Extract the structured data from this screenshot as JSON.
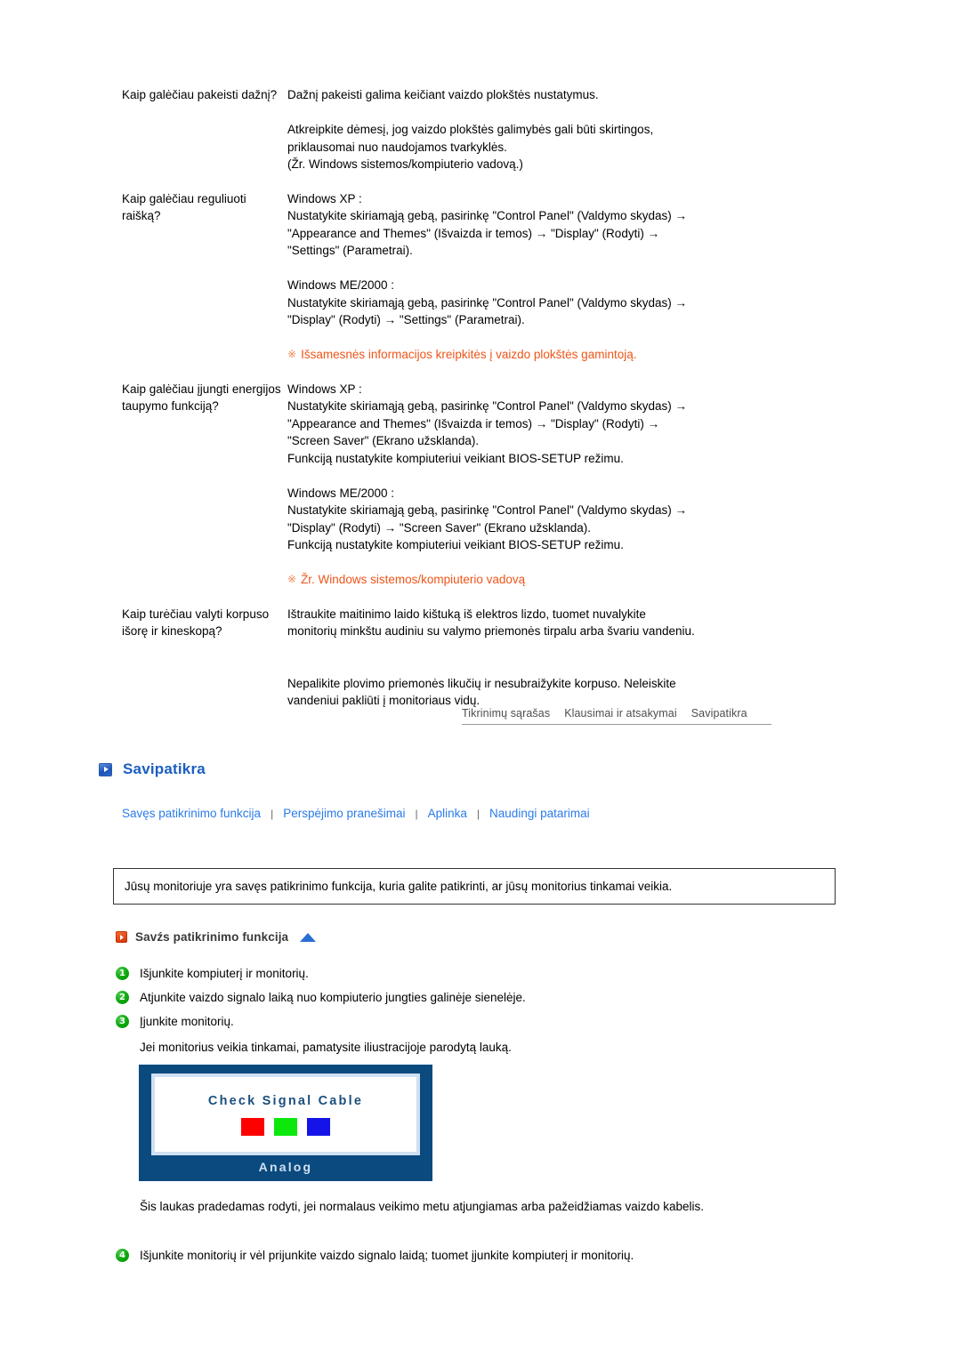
{
  "faq": {
    "items": [
      {
        "question": "Kaip galėčiau pakeisti dažnį?",
        "answer_blocks": [
          "Dažnį pakeisti galima keičiant vaizdo plokštės nustatymus.",
          "Atkreipkite dėmesį, jog vaizdo plokštės galimybės gali būti skirtingos,\npriklausomai nuo naudojamos tvarkyklės.\n(Žr. Windows sistemos/kompiuterio vadovą.)"
        ],
        "note": null
      },
      {
        "question": "Kaip galėčiau reguliuoti raišką?",
        "answer_blocks": [
          "Windows XP :\nNustatykite skiriamąją gebą, pasirinkę \"Control Panel\" (Valdymo skydas) →\n\"Appearance and Themes\" (Išvaizda ir temos) → \"Display\" (Rodyti) →\n\"Settings\" (Parametrai).",
          "Windows ME/2000 :\nNustatykite skiriamąją gebą, pasirinkę \"Control Panel\" (Valdymo skydas) →\n\"Display\" (Rodyti) → \"Settings\" (Parametrai)."
        ],
        "note": "Išsamesnės informacijos kreipkitės į vaizdo plokštės gamintoją."
      },
      {
        "question": "Kaip galėčiau įjungti energijos taupymo funkciją?",
        "answer_blocks": [
          "Windows XP :\nNustatykite skiriamąją gebą, pasirinkę \"Control Panel\" (Valdymo skydas) →\n\"Appearance and Themes\" (Išvaizda ir temos) → \"Display\" (Rodyti) →\n\"Screen Saver\" (Ekrano užsklanda).\nFunkciją nustatykite kompiuteriui veikiant BIOS-SETUP režimu.",
          "Windows ME/2000 :\nNustatykite skiriamąją gebą, pasirinkę \"Control Panel\" (Valdymo skydas) →\n\"Display\" (Rodyti) → \"Screen Saver\" (Ekrano užsklanda).\nFunkciją nustatykite kompiuteriui veikiant BIOS-SETUP režimu."
        ],
        "note": "Žr. Windows sistemos/kompiuterio vadovą"
      },
      {
        "question": "Kaip turėčiau valyti korpuso išorę ir kineskopą?",
        "answer_blocks": [
          "Ištraukite maitinimo laido kištuką iš elektros lizdo, tuomet nuvalykite\nmonitorių minkštu audiniu su valymo priemonės tirpalu arba švariu vandeniu.",
          "Nepalikite plovimo priemonės likučių ir nesubraižykite korpuso. Neleiskite\nvandeniui pakliūti į monitoriaus vidų."
        ],
        "note": null
      }
    ],
    "note_mark": "※"
  },
  "tabs": [
    {
      "label": "Tikrinimų sąrašas"
    },
    {
      "label": "Klausimai ir atsakymai"
    },
    {
      "label": "Savipatikra"
    }
  ],
  "section": {
    "title": "Savipatikra",
    "icon": "blue-play-square-icon"
  },
  "links": [
    {
      "label": "Savęs patikrinimo funkcija"
    },
    {
      "label": "Perspėjimo pranešimai"
    },
    {
      "label": "Aplinka"
    },
    {
      "label": "Naudingi patarimai"
    }
  ],
  "link_separator": "|",
  "infobox": {
    "text": "Jūsų monitoriuje yra savęs patikrinimo funkcija, kuria galite patikrinti, ar jūsų monitorius tinkamai veikia."
  },
  "subsection": {
    "title": "Savźs patikrinimo funkcija",
    "icon": "orange-play-square-icon",
    "collapse_icon": "blue-up-triangle-icon"
  },
  "steps": [
    {
      "num": "1",
      "text": "Išjunkite kompiuterį ir monitorių."
    },
    {
      "num": "2",
      "text": "Atjunkite vaizdo signalo laiką nuo kompiuterio jungties galinėje sienelėje."
    },
    {
      "num": "3",
      "text": "Įjunkite monitorių."
    }
  ],
  "step3_note": "Jei monitorius veikia tinkamai, pamatysite iliustracijoje parodytą lauką.",
  "osd": {
    "title": "Check Signal Cable",
    "footer": "Analog",
    "swatches": [
      {
        "name": "red-swatch",
        "color": "#fe0000"
      },
      {
        "name": "green-swatch",
        "color": "#0ce80c"
      },
      {
        "name": "blue-swatch",
        "color": "#1414e8"
      }
    ],
    "background": "#0b4a7e",
    "border": "#cfe0f2"
  },
  "bottom_paragraph": "Šis laukas pradedamas rodyti, jei normalaus veikimo metu atjungiamas arba pažeidžiamas vaizdo kabelis.",
  "last_step": {
    "num": "4",
    "text": "Išjunkite monitorių ir vėl prijunkite vaizdo signalo laidą; tuomet įjunkite kompiuterį ir monitorių."
  },
  "colors": {
    "link": "#2a7bea",
    "heading": "#1b5fc1",
    "note": "#ee5519",
    "note_mark": "#f08a5a",
    "step_badge": "#0aa80a",
    "tab_text": "#4d4d4d"
  }
}
